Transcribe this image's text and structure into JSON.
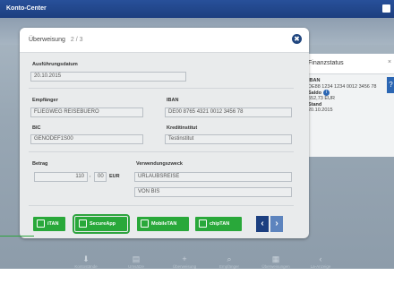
{
  "app": {
    "title": "Konto-Center"
  },
  "finanzstatus": {
    "title": "Finanzstatus",
    "close": "×",
    "help": "?",
    "iban_label": "IBAN",
    "iban_value": "DE88 1234 1234 0012 3456 78",
    "saldo_label": "Saldo",
    "saldo_value": "552,73 EUR",
    "stand_label": "Stand",
    "stand_value": "20.10.2015"
  },
  "dialog": {
    "title": "Überweisung",
    "step": "2 / 3",
    "close": "✖",
    "ausfuehrung_label": "Ausführungsdatum",
    "ausfuehrung_value": "20.10.2015",
    "empfaenger_label": "Empfänger",
    "empfaenger_value": "FLIEGWEG REISEBUERO",
    "iban_label": "IBAN",
    "iban_value": "DE00 8765 4321 0012 3456 78",
    "bic_label": "BIC",
    "bic_value": "GENODEF1S00",
    "kreditinstitut_label": "Kreditinstitut",
    "kreditinstitut_value": "Testinstitut",
    "betrag_label": "Betrag",
    "betrag_euro": "110",
    "betrag_sep": ",",
    "betrag_cent": "00",
    "betrag_currency": "EUR",
    "verwendung_label": "Verwendungszweck",
    "verwendung_line1": "URLAUBSREISE",
    "verwendung_line2": "VON BIS"
  },
  "tan_buttons": {
    "itan": "iTAN",
    "secureapp": "SecureApp",
    "mobiletan": "MobileTAN",
    "chiptan": "chipTAN",
    "prev": "‹",
    "next": "›"
  },
  "footer": [
    {
      "icon": "⬇",
      "label": "Kontostände"
    },
    {
      "icon": "▤",
      "label": "Umsätze"
    },
    {
      "icon": "+",
      "label": "Überweisung"
    },
    {
      "icon": "⌕",
      "label": "Empfänger"
    },
    {
      "icon": "▦",
      "label": "Überweisungen"
    },
    {
      "icon": "‹",
      "label": "La-Anzeige"
    }
  ],
  "colors": {
    "titlebar": "#1d3f7f",
    "green": "#29a83a",
    "blue": "#2b66b3"
  }
}
